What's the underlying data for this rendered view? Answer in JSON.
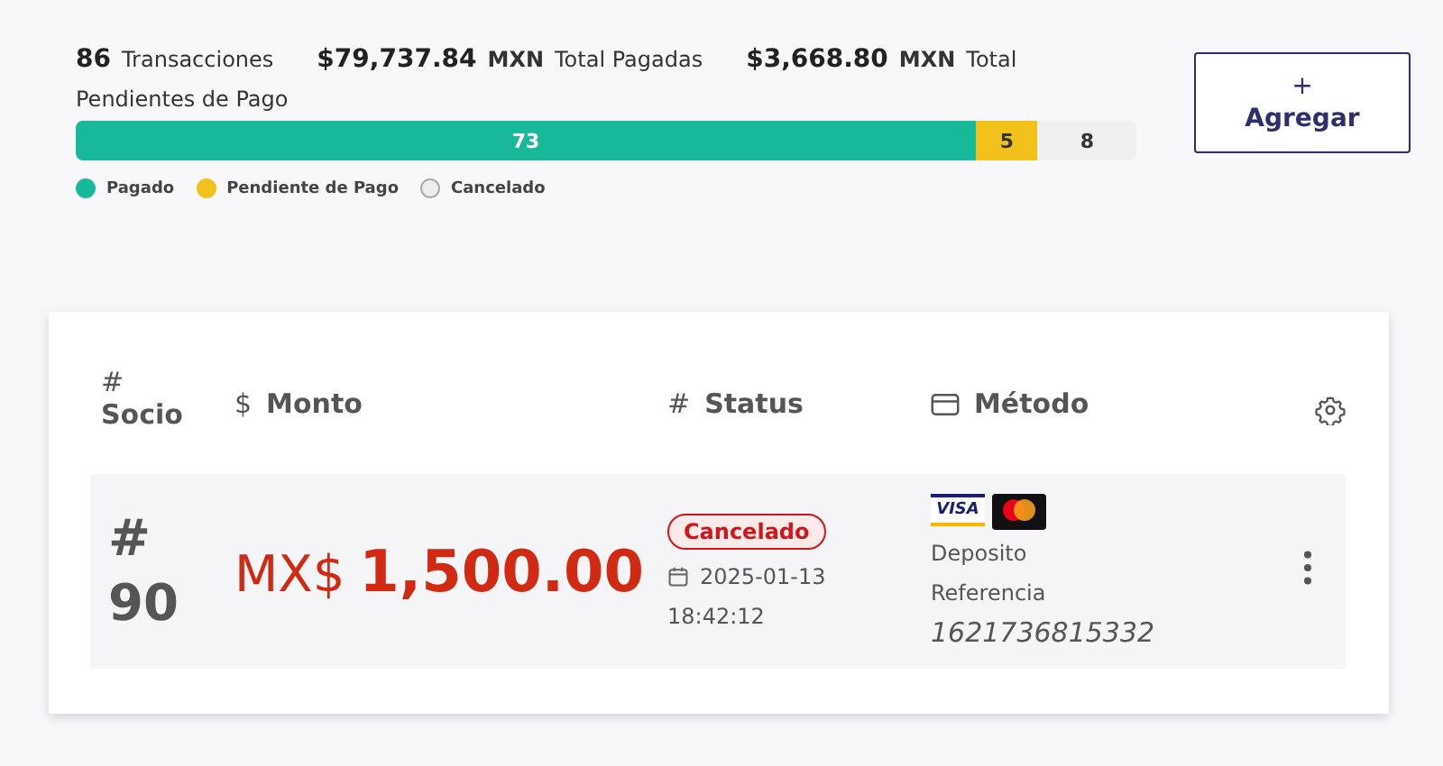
{
  "summary": {
    "count": "86",
    "count_label": "Transacciones",
    "paid_amount": "$79,737.84",
    "paid_currency": "MXN",
    "paid_label": "Total Pagadas",
    "pending_amount": "$3,668.80",
    "pending_currency": "MXN",
    "pending_label": "Total",
    "pending_label_2": "Pendientes de Pago"
  },
  "progress": [
    {
      "kind": "paid",
      "label": "73"
    },
    {
      "kind": "pending",
      "label": "5"
    },
    {
      "kind": "cancelled",
      "label": "8"
    }
  ],
  "legend": [
    {
      "kind": "paid",
      "label": "Pagado"
    },
    {
      "kind": "pending",
      "label": "Pendiente de Pago"
    },
    {
      "kind": "cancelled",
      "label": "Cancelado"
    }
  ],
  "add_button": {
    "icon": "+",
    "label": "Agregar"
  },
  "table": {
    "columns": [
      {
        "icon": "#",
        "label": "Socio"
      },
      {
        "icon": "$",
        "label": "Monto"
      },
      {
        "icon": "#",
        "label": "Status"
      },
      {
        "kind": "card",
        "label": "Método"
      }
    ],
    "rows": [
      {
        "socio_mark": "#",
        "socio": "90",
        "currency": "MX$",
        "amount": "1,500.00",
        "status": "Cancelado",
        "date": "2025-01-13",
        "time": "18:42:12",
        "card_brand": "VISA",
        "method": "Deposito",
        "reference_label": "Referencia",
        "reference": "1621736815332"
      }
    ]
  }
}
